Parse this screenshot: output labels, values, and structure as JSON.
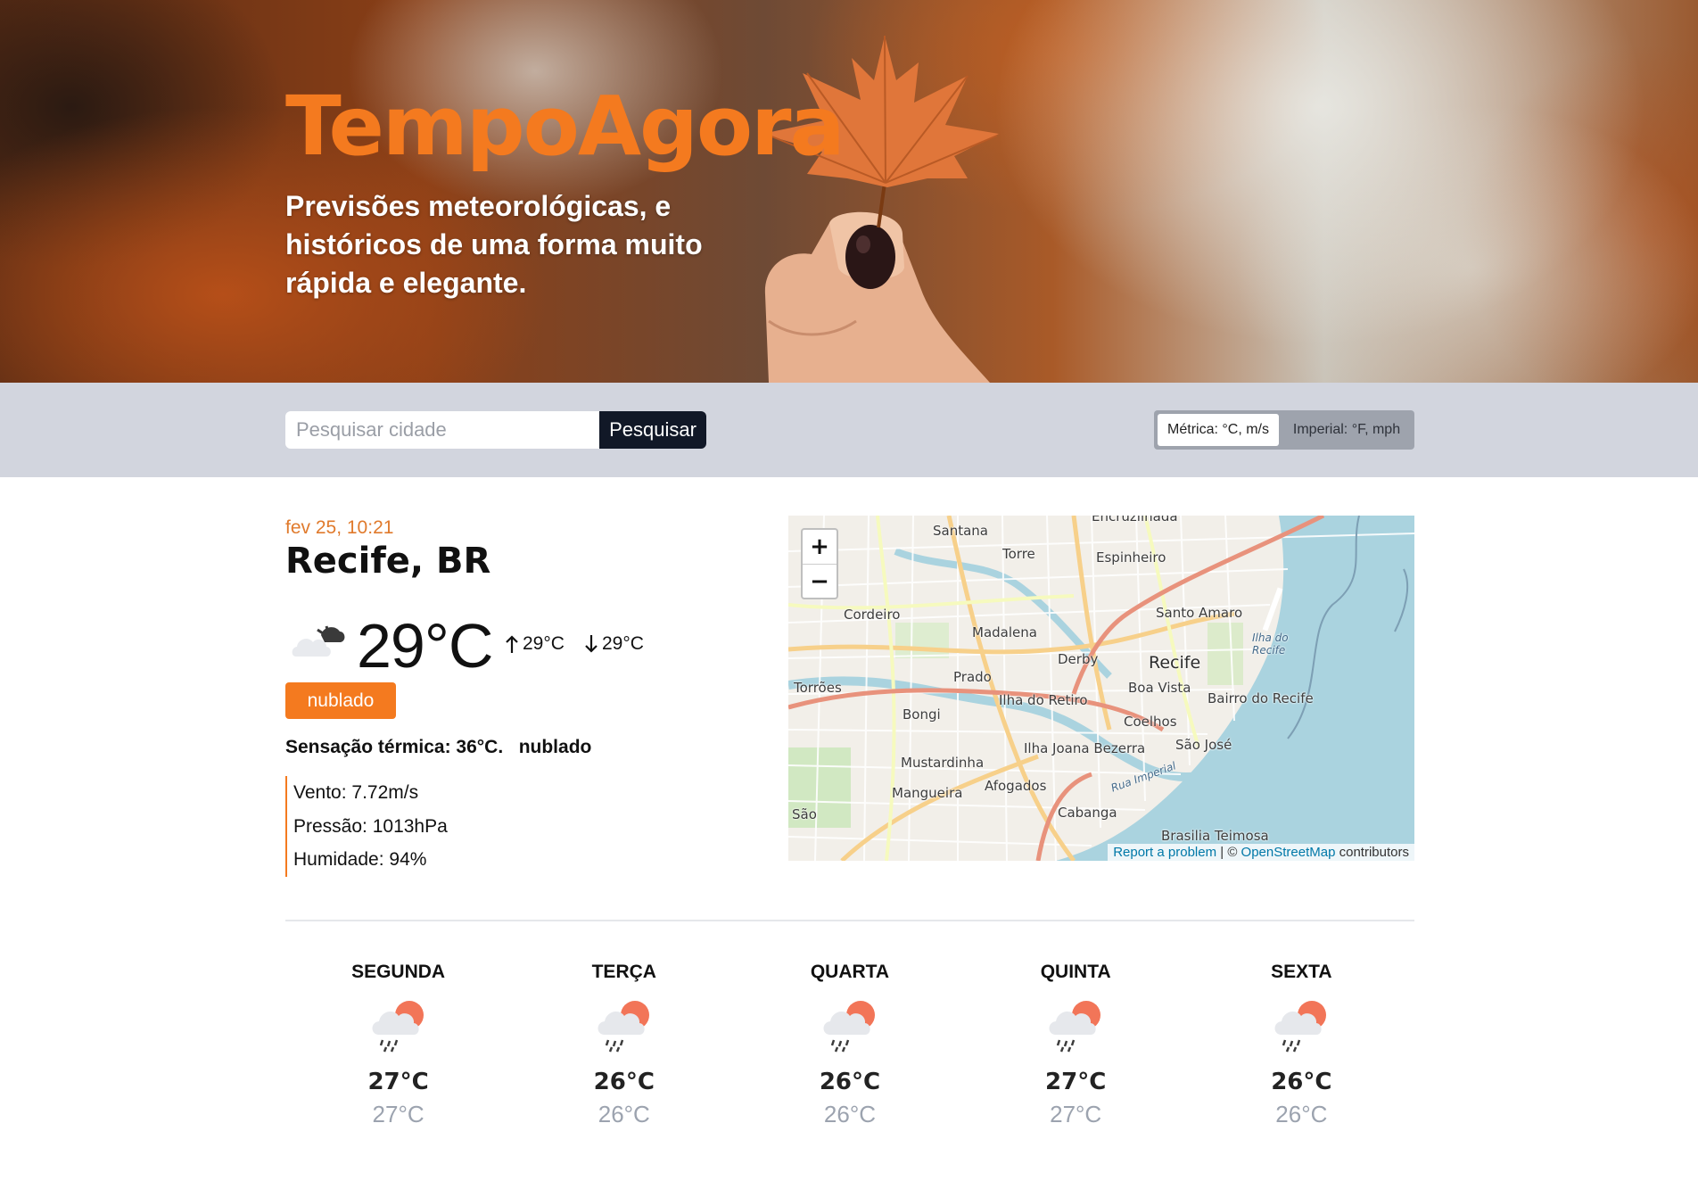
{
  "hero": {
    "title": "TempoAgora",
    "subtitle": "Previsões meteorológicas, e históricos de uma forma muito rápida e elegante."
  },
  "search": {
    "placeholder": "Pesquisar cidade",
    "value": "",
    "button_label": "Pesquisar"
  },
  "units": {
    "metric_label": "Métrica: °C, m/s",
    "imperial_label": "Imperial: °F, mph",
    "selected": "metric"
  },
  "current": {
    "datetime": "fev 25, 10:21",
    "location": "Recife, BR",
    "icon": "cloudy-icon",
    "temperature": "29°C",
    "max_temp": "29°C",
    "min_temp": "29°C",
    "condition": "nublado",
    "feels_like": "Sensação térmica: 36°C.",
    "feels_condition": "nublado",
    "wind": "Vento: 7.72m/s",
    "pressure": "Pressão: 1013hPa",
    "humidity": "Humidade: 94%"
  },
  "map": {
    "zoom_in": "+",
    "zoom_out": "−",
    "labels": {
      "santana": "Santana",
      "torre": "Torre",
      "espinheiro": "Espinheiro",
      "encruzilhada": "Encruzilhada",
      "cordeiro": "Cordeiro",
      "madalena": "Madalena",
      "santo_amaro": "Santo Amaro",
      "derby": "Derby",
      "recife": "Recife",
      "ilha_do_recife": "Ilha do Recife",
      "torroes": "Torrões",
      "prado": "Prado",
      "boa_vista": "Boa Vista",
      "bairro_do_recife": "Bairro do Recife",
      "bongi": "Bongi",
      "ilha_do_retiro": "Ilha do Retiro",
      "coelhos": "Coelhos",
      "sao_jose": "São José",
      "mustardinha": "Mustardinha",
      "ilha_joana_bezerra": "Ilha Joana Bezerra",
      "mangueira": "Mangueira",
      "afogados": "Afogados",
      "cabanga": "Cabanga",
      "sao": "São",
      "brasilia_teimosa": "Brasilia Teimosa",
      "rua_imperial": "Rua Imperial"
    },
    "attribution_report": "Report a problem",
    "attribution_sep": " | © ",
    "attribution_osm": "OpenStreetMap",
    "attribution_tail": " contributors"
  },
  "forecast": [
    {
      "day": "SEGUNDA",
      "icon": "rain-sun-icon",
      "max": "27°C",
      "min": "27°C"
    },
    {
      "day": "TERÇA",
      "icon": "rain-sun-icon",
      "max": "26°C",
      "min": "26°C"
    },
    {
      "day": "QUARTA",
      "icon": "rain-sun-icon",
      "max": "26°C",
      "min": "26°C"
    },
    {
      "day": "QUINTA",
      "icon": "rain-sun-icon",
      "max": "27°C",
      "min": "27°C"
    },
    {
      "day": "SEXTA",
      "icon": "rain-sun-icon",
      "max": "26°C",
      "min": "26°C"
    }
  ],
  "colors": {
    "accent": "#f47a1f",
    "dark_button": "#111827",
    "toolbar_bg": "#d2d5de"
  }
}
